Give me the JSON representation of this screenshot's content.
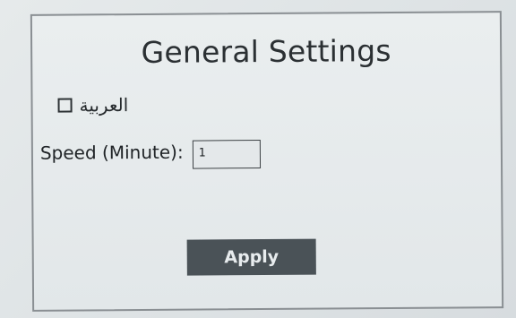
{
  "panel": {
    "title": "General Settings"
  },
  "language": {
    "label": "العربية",
    "checked": false
  },
  "speed": {
    "label": "Speed (Minute):",
    "value": "1"
  },
  "actions": {
    "apply_label": "Apply"
  }
}
